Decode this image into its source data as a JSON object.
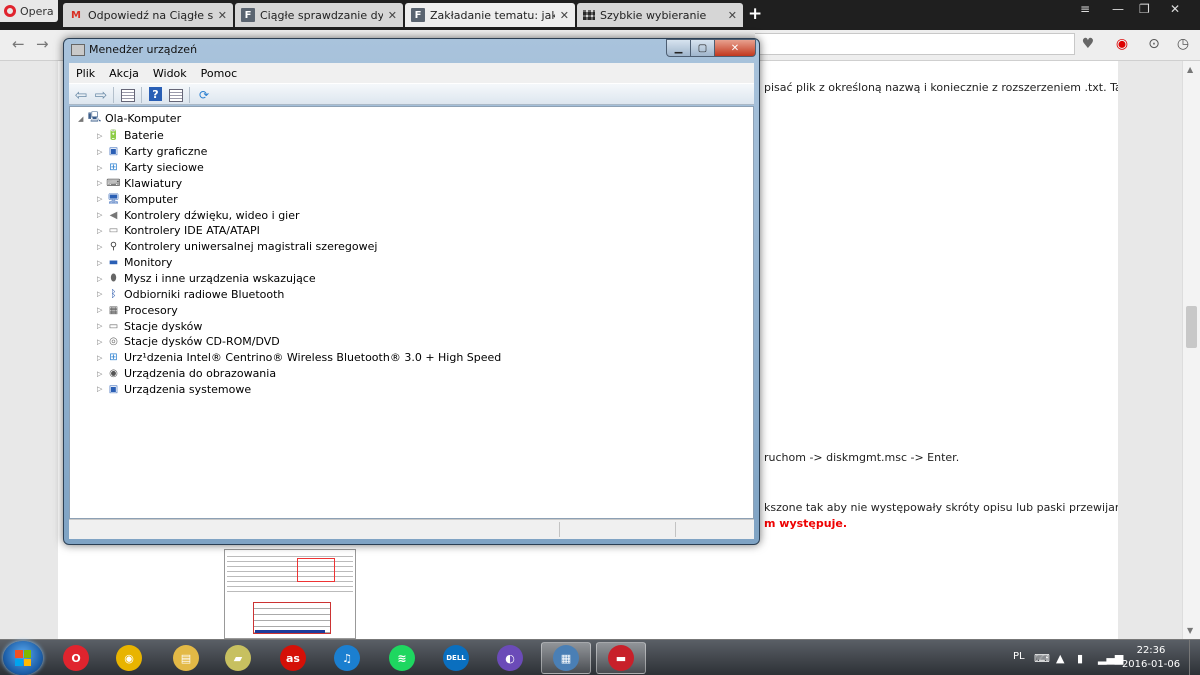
{
  "browser": {
    "menu_label": "Opera",
    "tabs": [
      {
        "label": "Odpowiedź na Ciągłe spra",
        "icon": "gmail-icon"
      },
      {
        "label": "Ciągłe sprawdzanie dysku",
        "icon": "forum-f-icon"
      },
      {
        "label": "Zakładanie tematu: jakie in",
        "icon": "forum-f-icon",
        "active": true
      },
      {
        "label": "Szybkie wybieranie",
        "icon": "speed-dial-icon"
      }
    ],
    "tab_close": "✕",
    "new_tab": "+"
  },
  "page": {
    "lines": [
      {
        "text": "pisać plik z określoną nazwą i koniecznie z rozszerzeniem .txt. Taki plik",
        "style": "normal"
      },
      {
        "text": "ruchom -> diskmgmt.msc -> Enter.",
        "style": "normal"
      },
      {
        "text": "kszone tak aby nie występowały skróty opisu lub paski przewijania.",
        "style": "normal"
      },
      {
        "text": "m występuje.",
        "style": "red"
      }
    ]
  },
  "device_manager": {
    "title": "Menedżer urządzeń",
    "menu": [
      "Plik",
      "Akcja",
      "Widok",
      "Pomoc"
    ],
    "root": "Ola-Komputer",
    "devices": [
      {
        "label": "Baterie",
        "icon": "battery-icon",
        "glyph": "🔋",
        "color": "#2e8b2e"
      },
      {
        "label": "Karty graficzne",
        "icon": "display-adapter-icon",
        "glyph": "▣",
        "color": "#2a5fb5"
      },
      {
        "label": "Karty sieciowe",
        "icon": "network-adapter-icon",
        "glyph": "⊞",
        "color": "#2a7fd0"
      },
      {
        "label": "Klawiatury",
        "icon": "keyboard-icon",
        "glyph": "⌨",
        "color": "#555"
      },
      {
        "label": "Komputer",
        "icon": "computer-icon",
        "glyph": "🖥",
        "color": "#2a5fb5"
      },
      {
        "label": "Kontrolery dźwięku, wideo i gier",
        "icon": "speaker-icon",
        "glyph": "◀",
        "color": "#777"
      },
      {
        "label": "Kontrolery IDE ATA/ATAPI",
        "icon": "ide-controller-icon",
        "glyph": "▭",
        "color": "#777"
      },
      {
        "label": "Kontrolery uniwersalnej magistrali szeregowej",
        "icon": "usb-icon",
        "glyph": "⚲",
        "color": "#444"
      },
      {
        "label": "Monitory",
        "icon": "monitor-icon",
        "glyph": "▬",
        "color": "#2a5fb5"
      },
      {
        "label": "Mysz i inne urządzenia wskazujące",
        "icon": "mouse-icon",
        "glyph": "⬮",
        "color": "#666"
      },
      {
        "label": "Odbiorniki radiowe Bluetooth",
        "icon": "bluetooth-icon",
        "glyph": "ᛒ",
        "color": "#1d4fa8"
      },
      {
        "label": "Procesory",
        "icon": "processor-icon",
        "glyph": "▦",
        "color": "#555"
      },
      {
        "label": "Stacje dysków",
        "icon": "disk-drive-icon",
        "glyph": "▭",
        "color": "#666"
      },
      {
        "label": "Stacje dysków CD-ROM/DVD",
        "icon": "cdrom-icon",
        "glyph": "◎",
        "color": "#666"
      },
      {
        "label": "Urz¹dzenia Intel® Centrino® Wireless Bluetooth® 3.0 + High Speed",
        "icon": "intel-bluetooth-icon",
        "glyph": "⊞",
        "color": "#2a7fd0"
      },
      {
        "label": "Urządzenia do obrazowania",
        "icon": "camera-icon",
        "glyph": "◉",
        "color": "#555"
      },
      {
        "label": "Urządzenia systemowe",
        "icon": "system-devices-icon",
        "glyph": "▣",
        "color": "#2a5fb5"
      }
    ]
  },
  "taskbar": {
    "apps": [
      {
        "name": "taskbar-opera",
        "glyph": "O",
        "bg": "#e0242e"
      },
      {
        "name": "taskbar-chrome",
        "glyph": "◉",
        "bg": "#e8b400"
      },
      {
        "name": "taskbar-explorer",
        "glyph": "▤",
        "bg": "#e3b946"
      },
      {
        "name": "taskbar-folder",
        "glyph": "▰",
        "bg": "#c7c060"
      },
      {
        "name": "taskbar-lastfm",
        "glyph": "as",
        "bg": "#d51007"
      },
      {
        "name": "taskbar-itunes",
        "glyph": "♫",
        "bg": "#1b7fd0"
      },
      {
        "name": "taskbar-spotify",
        "glyph": "≋",
        "bg": "#1ed760"
      },
      {
        "name": "taskbar-dell",
        "glyph": "DELL",
        "bg": "#0a6fbf"
      },
      {
        "name": "taskbar-bittorrent",
        "glyph": "◐",
        "bg": "#6b4bb8"
      },
      {
        "name": "taskbar-device-manager",
        "glyph": "▦",
        "bg": "#4a7fb5",
        "active": true
      },
      {
        "name": "taskbar-toolbox",
        "glyph": "▬",
        "bg": "#c8202a",
        "active": true
      }
    ],
    "lang": "PL",
    "time": "22:36",
    "date": "2016-01-06"
  }
}
